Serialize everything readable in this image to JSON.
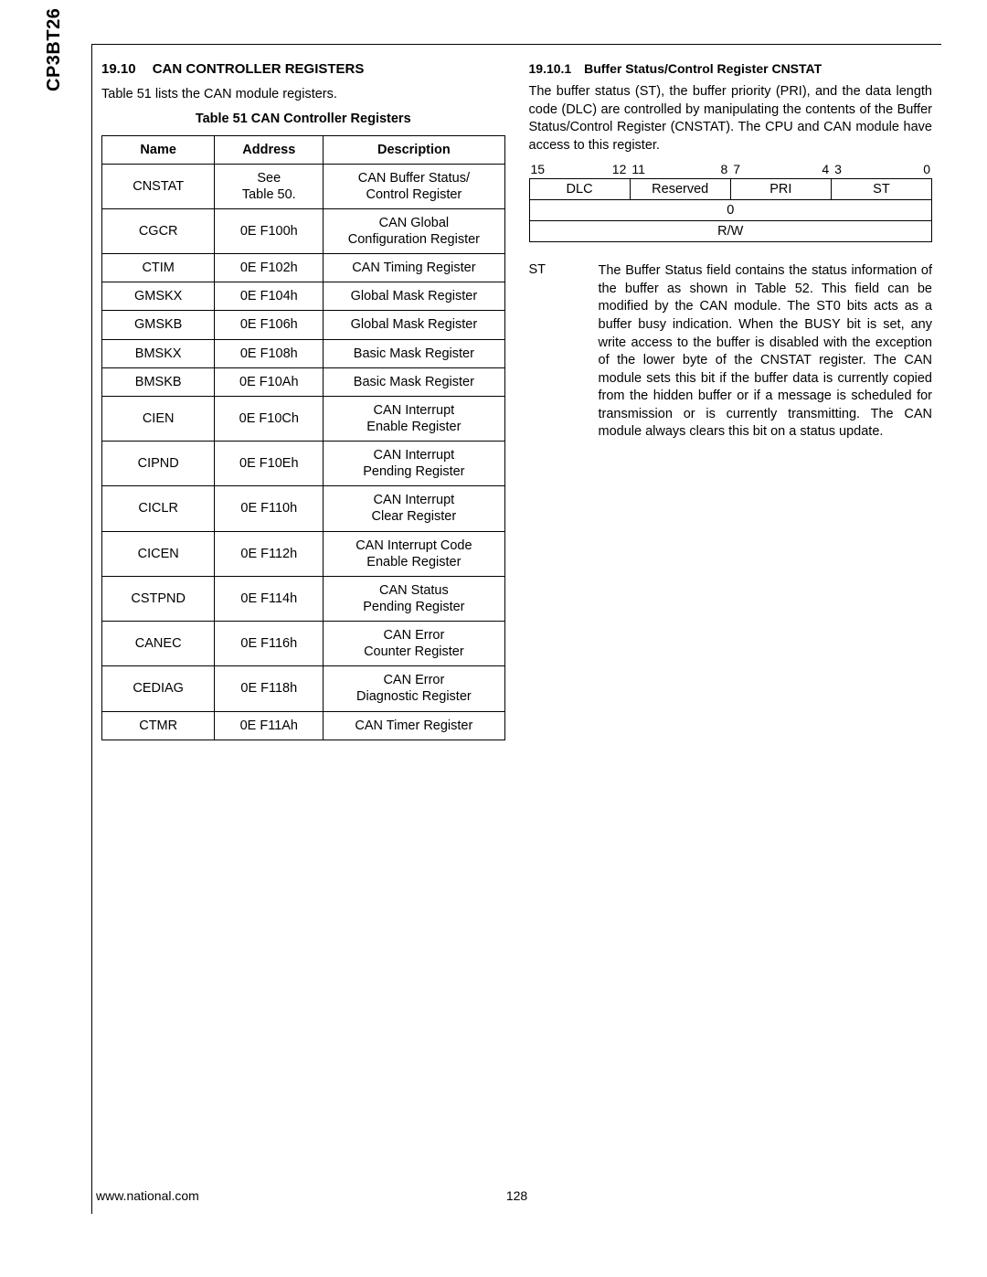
{
  "sideLabel": "CP3BT26",
  "left": {
    "secNum": "19.10",
    "secTitle": "CAN CONTROLLER REGISTERS",
    "intro": "Table 51 lists the CAN module registers.",
    "tableCaption": "Table 51   CAN Controller Registers",
    "head": {
      "name": "Name",
      "address": "Address",
      "description": "Description"
    },
    "rows": [
      {
        "name": "CNSTAT",
        "address": "See\nTable 50.",
        "description": "CAN Buffer Status/\nControl Register"
      },
      {
        "name": "CGCR",
        "address": "0E F100h",
        "description": "CAN Global\nConfiguration Register"
      },
      {
        "name": "CTIM",
        "address": "0E F102h",
        "description": "CAN Timing Register"
      },
      {
        "name": "GMSKX",
        "address": "0E F104h",
        "description": "Global Mask Register"
      },
      {
        "name": "GMSKB",
        "address": "0E F106h",
        "description": "Global Mask Register"
      },
      {
        "name": "BMSKX",
        "address": "0E F108h",
        "description": "Basic Mask Register"
      },
      {
        "name": "BMSKB",
        "address": "0E F10Ah",
        "description": "Basic Mask Register"
      },
      {
        "name": "CIEN",
        "address": "0E F10Ch",
        "description": "CAN Interrupt\nEnable Register"
      },
      {
        "name": "CIPND",
        "address": "0E F10Eh",
        "description": "CAN Interrupt\nPending Register"
      },
      {
        "name": "CICLR",
        "address": "0E F110h",
        "description": "CAN Interrupt\nClear Register"
      },
      {
        "name": "CICEN",
        "address": "0E F112h",
        "description": "CAN Interrupt Code\nEnable Register"
      },
      {
        "name": "CSTPND",
        "address": "0E F114h",
        "description": "CAN Status\nPending Register"
      },
      {
        "name": "CANEC",
        "address": "0E F116h",
        "description": "CAN Error\nCounter Register"
      },
      {
        "name": "CEDIAG",
        "address": "0E F118h",
        "description": "CAN Error\nDiagnostic Register"
      },
      {
        "name": "CTMR",
        "address": "0E F11Ah",
        "description": "CAN Timer Register"
      }
    ]
  },
  "right": {
    "subNum": "19.10.1",
    "subTitle": "Buffer Status/Control Register CNSTAT",
    "para": "The buffer status (ST), the buffer priority (PRI), and the data length code (DLC) are controlled by manipulating the contents of the Buffer Status/Control Register (CNSTAT). The CPU and CAN module have access to this register.",
    "bits": {
      "n15": "15",
      "n12": "12",
      "n11": "11",
      "n8": "8",
      "n7": "7",
      "n4": "4",
      "n3": "3",
      "n0": "0",
      "f1": "DLC",
      "f2": "Reserved",
      "f3": "PRI",
      "f4": "ST",
      "reset": "0",
      "access": "R/W"
    },
    "def": {
      "name": "ST",
      "text": "The Buffer Status field contains the status information of the buffer as shown in Table 52. This field can be modified by the CAN module. The ST0 bits acts as a buffer busy indication. When the BUSY bit is set, any write access to the buffer is disabled with the exception of the lower byte of the CNSTAT register. The CAN module sets this bit if the buffer data is currently copied from the hidden buffer or if a message is scheduled for transmission or is currently transmitting. The CAN module always clears this bit on a status update."
    }
  },
  "footer": {
    "url": "www.national.com",
    "page": "128"
  }
}
